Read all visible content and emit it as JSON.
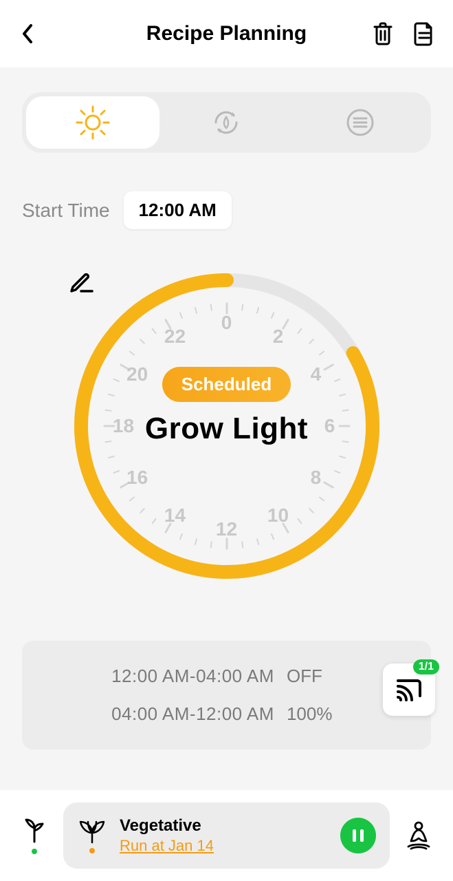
{
  "header": {
    "title": "Recipe Planning"
  },
  "tabs": {
    "active_index": 0
  },
  "start_time": {
    "label": "Start Time",
    "value": "12:00 AM"
  },
  "dial": {
    "status_label": "Scheduled",
    "title": "Grow Light",
    "hours": [
      "0",
      "2",
      "4",
      "6",
      "8",
      "10",
      "12",
      "14",
      "16",
      "18",
      "20",
      "22"
    ],
    "active_start_hour": 4,
    "active_end_hour": 24
  },
  "schedule": [
    {
      "range": "12:00 AM-04:00 AM",
      "value": "OFF"
    },
    {
      "range": "04:00 AM-12:00 AM",
      "value": "100%"
    }
  ],
  "cast": {
    "badge": "1/1"
  },
  "bottom": {
    "stage_name": "Vegetative",
    "stage_sub": "Run at Jan 14"
  },
  "colors": {
    "accent": "#f7b416",
    "accent_dark": "#f69a12",
    "green": "#19c443",
    "gray": "#c8c8c8",
    "panel": "#ececec"
  }
}
